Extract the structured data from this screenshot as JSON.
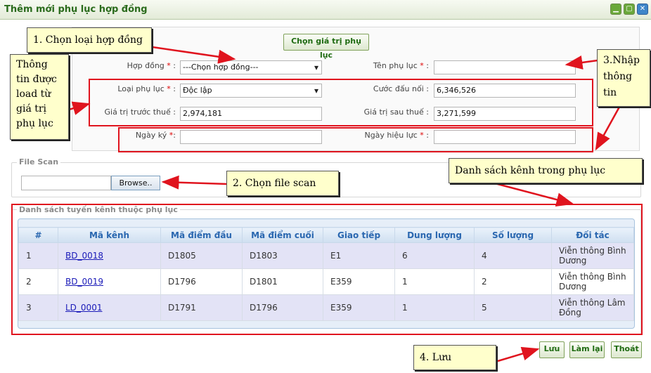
{
  "window": {
    "title": "Thêm mới phụ lục hợp đồng"
  },
  "form": {
    "load_button": "Chọn giá trị phụ lục",
    "hop_dong_label": "Hợp đồng",
    "hop_dong_value": "---Chọn hợp đồng---",
    "ten_phu_luc_label": "Tên phụ lục",
    "ten_phu_luc_value": "",
    "loai_phu_luc_label": "Loại phụ lục",
    "loai_phu_luc_value": "Độc lập",
    "cuoc_dau_noi_label": "Cước đấu nối :",
    "cuoc_dau_noi_value": "6,346,526",
    "gia_tri_truoc_label": "Giá trị trước thuế :",
    "gia_tri_truoc_value": "2,974,181",
    "gia_tri_sau_label": "Giá trị sau thuế :",
    "gia_tri_sau_value": "3,271,599",
    "ngay_ky_label": "Ngày ký",
    "ngay_ky_value": "",
    "ngay_hieu_luc_label": "Ngày hiệu lực",
    "ngay_hieu_luc_value": "",
    "required_mark": "*",
    "colon": ":"
  },
  "file_scan": {
    "legend": "File Scan",
    "path": "",
    "browse_button": "Browse.."
  },
  "channels": {
    "legend": "Danh sách tuyến kênh thuộc phụ lục",
    "columns": [
      "#",
      "Mã kênh",
      "Mã điểm đầu",
      "Mã điểm cuối",
      "Giao tiếp",
      "Dung lượng",
      "Số lượng",
      "Đối tác"
    ],
    "rows": [
      [
        "1",
        "BD_0018",
        "D1805",
        "D1803",
        "E1",
        "6",
        "4",
        "Viễn thông Bình Dương"
      ],
      [
        "2",
        "BD_0019",
        "D1796",
        "D1801",
        "E359",
        "1",
        "2",
        "Viễn thông Bình Dương"
      ],
      [
        "3",
        "LD_0001",
        "D1791",
        "D1796",
        "E359",
        "1",
        "5",
        "Viễn thông Lâm Đồng"
      ]
    ]
  },
  "actions": {
    "save": "Lưu",
    "reset": "Làm lại",
    "exit": "Thoát"
  },
  "callouts": {
    "step1": "1. Chọn loại hợp đồng",
    "info_loaded": "Thông tin được load từ giá trị phụ lục",
    "step3": "3.Nhập thông tin",
    "step2": "2. Chọn file scan",
    "channel_list": "Danh sách kênh trong phụ lục",
    "step4": "4. Lưu"
  },
  "icons": {
    "minimize": "minimize-icon",
    "maximize": "maximize-icon",
    "close": "close-icon"
  },
  "colors": {
    "annotation_red": "#e0141e",
    "callout_bg": "#ffffcc",
    "header_text": "#2a67b0",
    "title_green": "#2a6b1c"
  }
}
